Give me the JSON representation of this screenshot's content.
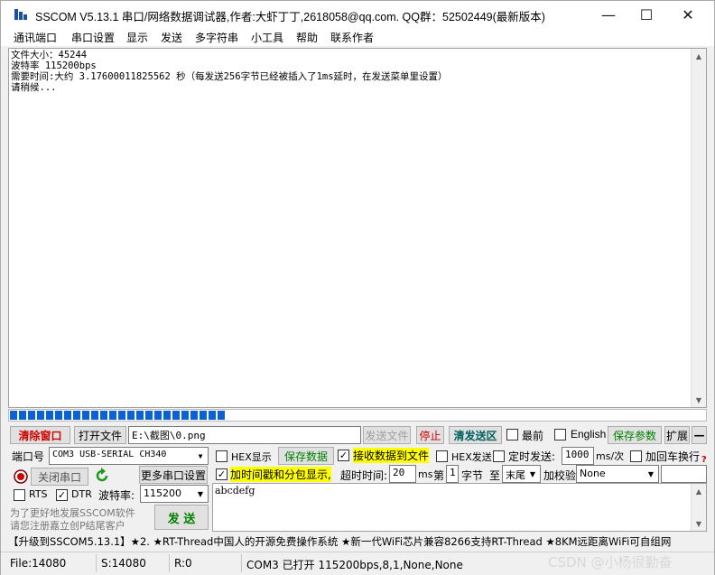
{
  "window": {
    "title": "SSCOM V5.13.1 串口/网络数据调试器,作者:大虾丁丁,2618058@qq.com. QQ群：52502449(最新版本)",
    "minimize_icon": "minimize-icon",
    "maximize_icon": "maximize-icon",
    "close_icon": "close-icon"
  },
  "menu": [
    "通讯端口",
    "串口设置",
    "显示",
    "发送",
    "多字符串",
    "小工具",
    "帮助",
    "联系作者"
  ],
  "receive": {
    "lines": [
      "文件大小：45244",
      "波特率 115200bps",
      "需要时间:大约 3.17600011825562 秒（每发送256字节已经被插入了1ms延时，在发送菜单里设置）",
      "请稍候..."
    ]
  },
  "progress": {
    "fraction": 0.31
  },
  "toolbar1": {
    "clear_window": "清除窗口",
    "open_file": "打开文件",
    "file_path": "E:\\截图\\0.png",
    "send_file": "发送文件",
    "stop": "停止",
    "clear_send": "清发送区",
    "top_label": "最前",
    "english_label": "English",
    "save_params": "保存参数",
    "expand": "扩展",
    "collapse": "—"
  },
  "port": {
    "port_label": "端口号",
    "port_value": "COM3 USB-SERIAL CH340",
    "hex_display": "HEX显示",
    "save_data": "保存数据",
    "recv_to_file": "接收数据到文件",
    "hex_send": "HEX发送",
    "timed_send": "定时发送:",
    "interval": "1000",
    "interval_unit": "ms/次",
    "add_crlf": "加回车换行",
    "help_mark": "?",
    "close_port": "关闭串口",
    "more_ports": "更多串口设置",
    "timestamp": "加时间戳和分包显示,",
    "timeout_label": "超时时间:",
    "timeout": "20",
    "timeout_unit": "ms",
    "nth_label": "第",
    "nth": "1",
    "byte_label": "字节",
    "to_label": "至",
    "end_value": "末尾",
    "checksum_label": "加校验",
    "checksum_value": "None",
    "rts": "RTS",
    "dtr": "DTR",
    "baud_label": "波特率:",
    "baud": "115200",
    "send_text": "abcdefg",
    "promo1": "为了更好地发展SSCOM软件",
    "promo2": "请您注册嘉立创P结尾客户",
    "send_button": "发 送"
  },
  "ticker": "【升级到SSCOM5.13.1】★2. ★RT-Thread中国人的开源免费操作系统 ★新一代WiFi芯片兼容8266支持RT-Thread ★8KM远距离WiFi可自组网",
  "status": {
    "file": "File:14080",
    "sent": "S:14080",
    "recv": "R:0",
    "port_status": "COM3 已打开  115200bps,8,1,None,None",
    "watermark": "CSDN @小杨很勤奋"
  },
  "colors": {
    "highlight": "#ffff00",
    "progress": "#0a62d6",
    "red_text": "#d00000",
    "green_text": "#008000"
  }
}
